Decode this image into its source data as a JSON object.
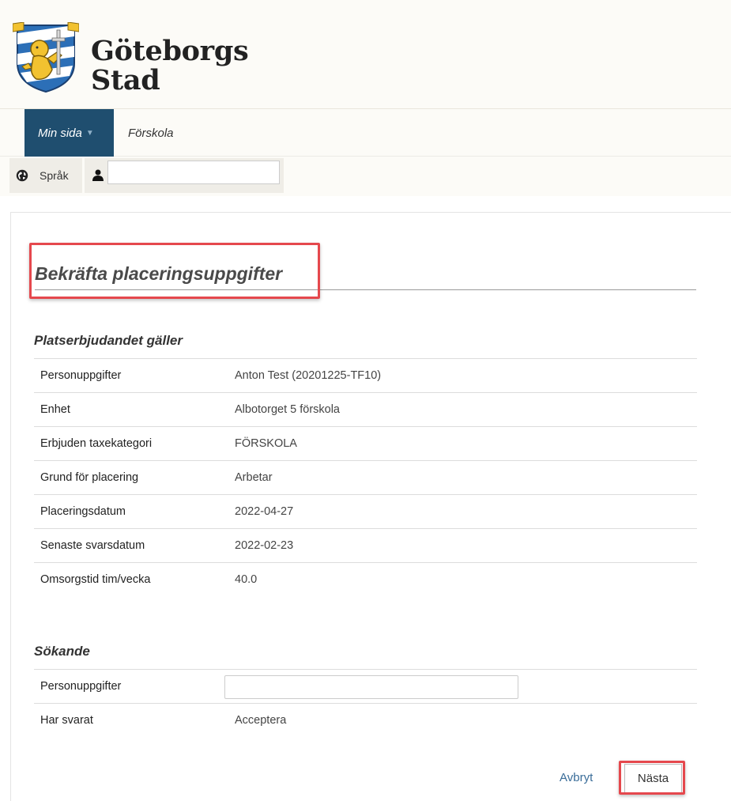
{
  "header": {
    "brand_line1": "Göteborgs",
    "brand_line2": "Stad"
  },
  "nav": {
    "items": [
      {
        "label": "Min sida",
        "active": true,
        "has_dropdown": true
      },
      {
        "label": "Förskola",
        "active": false
      }
    ]
  },
  "toolbar": {
    "language_label": "Språk",
    "user_field_value": ""
  },
  "page": {
    "title": "Bekräfta placeringsuppgifter"
  },
  "offer_section": {
    "title": "Platserbjudandet gäller",
    "rows": [
      {
        "label": "Personuppgifter",
        "value": "Anton Test (20201225-TF10)"
      },
      {
        "label": "Enhet",
        "value": "Albotorget 5 förskola"
      },
      {
        "label": "Erbjuden taxekategori",
        "value": "FÖRSKOLA"
      },
      {
        "label": "Grund för placering",
        "value": "Arbetar"
      },
      {
        "label": "Placeringsdatum",
        "value": "2022-04-27"
      },
      {
        "label": "Senaste svarsdatum",
        "value": "2022-02-23"
      },
      {
        "label": "Omsorgstid tim/vecka",
        "value": "40.0"
      }
    ]
  },
  "applicant_section": {
    "title": "Sökande",
    "person_label": "Personuppgifter",
    "person_value": "",
    "answered_label": "Har svarat",
    "answered_value": "Acceptera"
  },
  "actions": {
    "cancel_label": "Avbryt",
    "next_label": "Nästa"
  },
  "colors": {
    "nav_active_bg": "#1f4e6f",
    "highlight": "#e5484d",
    "link": "#3a6d99"
  },
  "icons": {
    "logo": "coat-of-arms-icon",
    "language": "globe-icon",
    "user": "user-icon",
    "dropdown": "caret-down-icon"
  }
}
